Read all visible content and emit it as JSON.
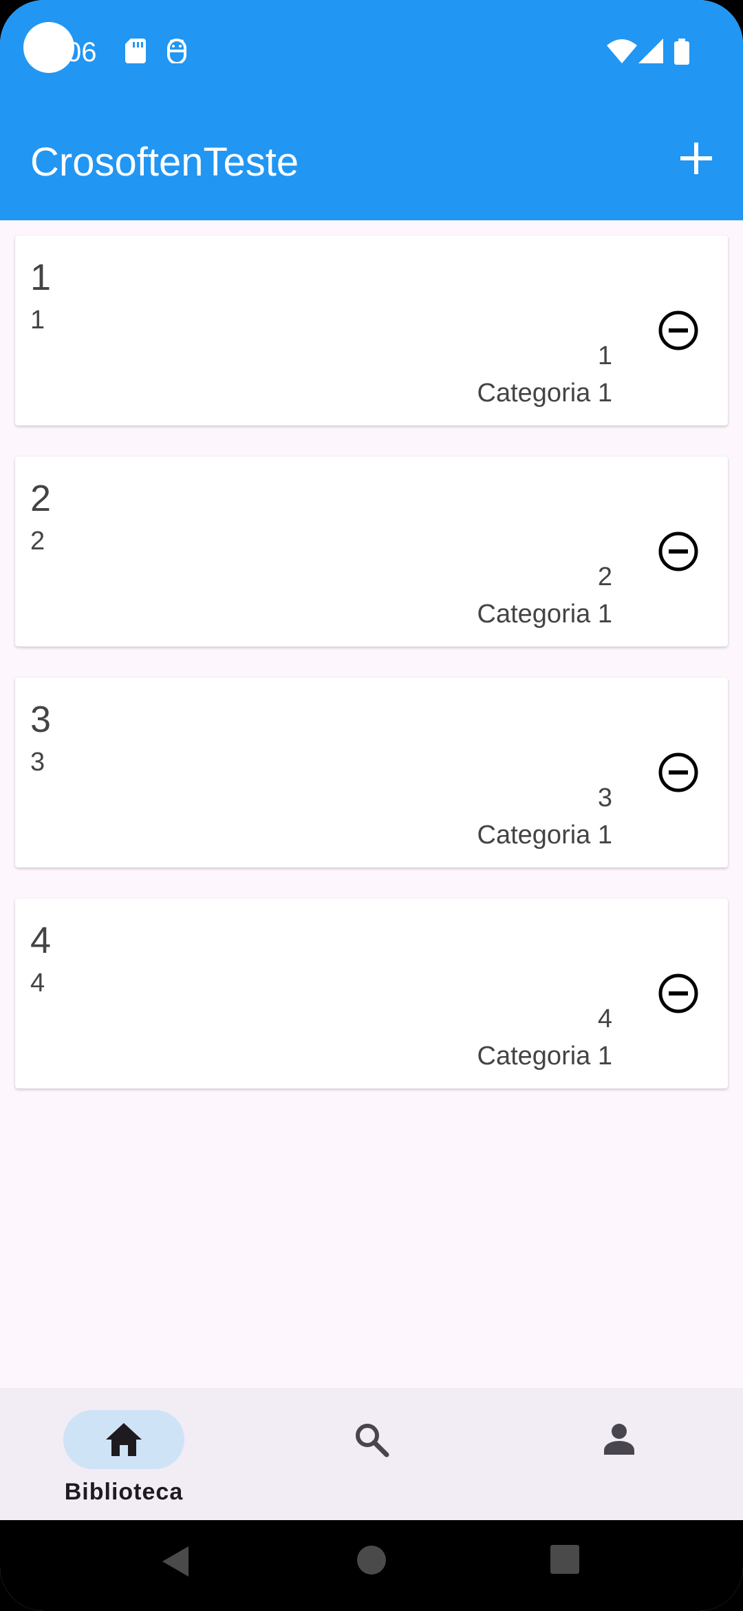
{
  "status_bar": {
    "time": "06",
    "icons": [
      "sd-card-icon",
      "android-debug-icon",
      "wifi-icon",
      "signal-icon",
      "battery-icon"
    ]
  },
  "app_bar": {
    "title": "CrosoftenTeste",
    "add_icon": "plus-icon"
  },
  "items": [
    {
      "title": "1",
      "subtitle": "1",
      "value": "1",
      "category": "Categoria 1"
    },
    {
      "title": "2",
      "subtitle": "2",
      "value": "2",
      "category": "Categoria 1"
    },
    {
      "title": "3",
      "subtitle": "3",
      "value": "3",
      "category": "Categoria 1"
    },
    {
      "title": "4",
      "subtitle": "4",
      "value": "4",
      "category": "Categoria 1"
    }
  ],
  "bottom_nav": {
    "items": [
      {
        "label": "Biblioteca",
        "icon": "home-icon",
        "selected": true
      },
      {
        "label": "",
        "icon": "search-icon",
        "selected": false
      },
      {
        "label": "",
        "icon": "person-icon",
        "selected": false
      }
    ]
  },
  "colors": {
    "primary": "#2196F3",
    "background": "#FDF7FD",
    "nav_background": "#F2ECF4",
    "nav_indicator": "#CFE3F6"
  }
}
